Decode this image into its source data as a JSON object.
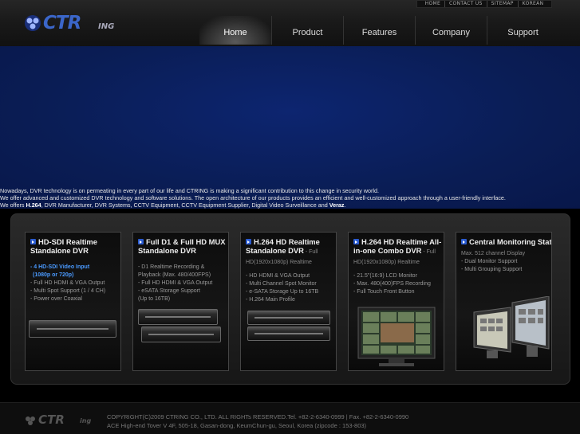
{
  "utility": [
    "HOME",
    "CONTACT US",
    "SITEMAP",
    "KOREAN"
  ],
  "logo": {
    "word": "CTR",
    "suffix": "ING"
  },
  "nav": [
    "Home",
    "Product",
    "Features",
    "Company",
    "Support"
  ],
  "intro": {
    "line1": "Nowadays, DVR technology is on permeating in every part of our life and CTRING is making a significant contribution to this change in security world.",
    "line2": "We offer advanced and customized DVR technology and software solutions. The open architecture of our products provides an efficient and well-customized approach through a user-friendly interface.",
    "line3_a": "We offers ",
    "line3_b": "H.264",
    "line3_c": ", DVR Manufacturer, DVR Systems, CCTV Equipment, CCTV Equipment Supplier, Digital Video Surveillance and ",
    "line3_d": "Veraz",
    "line3_e": "."
  },
  "products": [
    {
      "title": "HD-SDI Realtime Standalone DVR",
      "sub": "",
      "highlight": [
        "- 4 HD-SDI Video Input",
        "(1080p or 720p)"
      ],
      "features": [
        "- Full HD HDMI & VGA Output",
        "- Multi Spot Support (1 / 4 CH)",
        "- Power over Coaxial"
      ]
    },
    {
      "title": "Full D1 & Full HD MUX Standalone DVR",
      "sub": "",
      "highlight": [],
      "features": [
        "- D1 Realtime Recording &",
        "  Playback (Max. 480/400FPS)",
        "- Full HD HDMI & VGA Output",
        "- eSATA Storage Support",
        "  (Up to 16TB)"
      ]
    },
    {
      "title": "H.264 HD Realtime Standalone DVR",
      "sub": " - Full HD(1920x1080p) Realtime",
      "highlight": [],
      "features": [
        "- HD HDMI & VGA Output",
        "- Multi Channel Spot Monitor",
        "- e-SATA Storage Up to 16TB",
        "- H.264 Main Profile"
      ]
    },
    {
      "title": "H.264 HD Realtime All-in-one Combo DVR",
      "sub": " - Full HD(1920x1080p) Realtime",
      "highlight": [],
      "features": [
        "- 21.5\"(16:9) LCD Monitor",
        "- Max. 480(400)FPS Recording",
        "- Full Touch Front Button"
      ]
    },
    {
      "title": "Central Monitoring Station",
      "sub": " - Max. 512 channel Display",
      "highlight": [],
      "features": [
        "- Dual Monitor Support",
        "- Multi Grouping Support"
      ]
    }
  ],
  "footer": {
    "logo": "CTR",
    "logo_suffix": "ing",
    "line1": "COPYRIGHT(C)2009 CTRING CO., LTD. ALL RIGHTs RESERVED.Tel. +82-2-6340-0999 | Fax. +82-2-6340-0990",
    "line2": "ACE High-end Tover V 4F, 505-18, Gasan-dong, KeumChun-gu, Seoul, Korea (zipcode : 153-803)"
  },
  "colors": {
    "accent": "#3b66c9",
    "hero": "#0b1f5c",
    "highlight": "#4a9aff"
  }
}
